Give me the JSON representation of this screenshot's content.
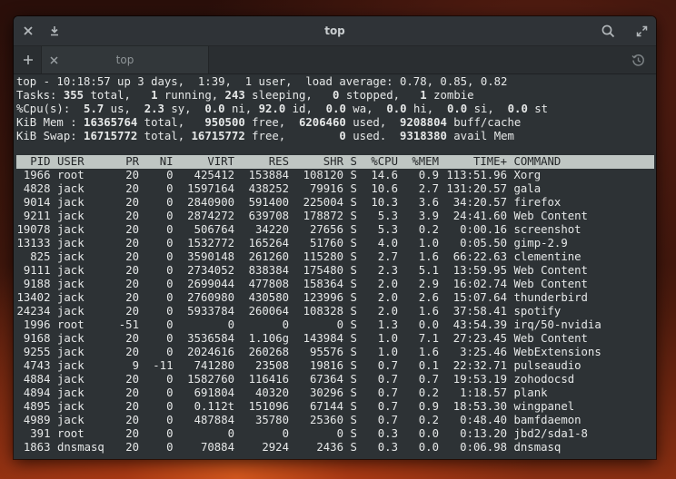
{
  "window": {
    "title": "top"
  },
  "tabs": [
    {
      "label": "top"
    }
  ],
  "summary": {
    "line1": "top - 10:18:57 up 3 days,  1:39,  1 user,  load average: 0.78, 0.85, 0.82",
    "tasks": {
      "label": "Tasks:",
      "total": "355",
      "total_l": " total,",
      "running": "1",
      "running_l": " running,",
      "sleeping": "243",
      "sleeping_l": " sleeping,",
      "stopped": "0",
      "stopped_l": " stopped,",
      "zombie": "1",
      "zombie_l": " zombie"
    },
    "cpu": {
      "label": "%Cpu(s):",
      "us": "5.7",
      "us_l": " us,",
      "sy": "2.3",
      "sy_l": " sy,",
      "ni": "0.0",
      "ni_l": " ni,",
      "id": "92.0",
      "id_l": " id,",
      "wa": "0.0",
      "wa_l": " wa,",
      "hi": "0.0",
      "hi_l": " hi,",
      "si": "0.0",
      "si_l": " si,",
      "st": "0.0",
      "st_l": " st"
    },
    "mem": {
      "label": "KiB Mem :",
      "total": "16365764",
      "total_l": " total,",
      "free": "950500",
      "free_l": " free,",
      "used": "6206460",
      "used_l": " used,",
      "buff": "9208804",
      "buff_l": " buff/cache"
    },
    "swap": {
      "label": "KiB Swap:",
      "total": "16715772",
      "total_l": " total,",
      "free": "16715772",
      "free_l": " free,",
      "used": "0",
      "used_l": " used.",
      "avail": "9318380",
      "avail_l": " avail Mem"
    }
  },
  "columns": [
    "PID",
    "USER",
    "PR",
    "NI",
    "VIRT",
    "RES",
    "SHR",
    "S",
    "%CPU",
    "%MEM",
    "TIME+",
    "COMMAND"
  ],
  "processes": [
    [
      "1966",
      "root",
      "20",
      "0",
      "425412",
      "153884",
      "108120",
      "S",
      "14.6",
      "0.9",
      "113:51.96",
      "Xorg"
    ],
    [
      "4828",
      "jack",
      "20",
      "0",
      "1597164",
      "438252",
      "79916",
      "S",
      "10.6",
      "2.7",
      "131:20.57",
      "gala"
    ],
    [
      "9014",
      "jack",
      "20",
      "0",
      "2840900",
      "591400",
      "225004",
      "S",
      "10.3",
      "3.6",
      "34:20.57",
      "firefox"
    ],
    [
      "9211",
      "jack",
      "20",
      "0",
      "2874272",
      "639708",
      "178872",
      "S",
      "5.3",
      "3.9",
      "24:41.60",
      "Web Content"
    ],
    [
      "19078",
      "jack",
      "20",
      "0",
      "506764",
      "34220",
      "27656",
      "S",
      "5.3",
      "0.2",
      "0:00.16",
      "screenshot"
    ],
    [
      "13133",
      "jack",
      "20",
      "0",
      "1532772",
      "165264",
      "51760",
      "S",
      "4.0",
      "1.0",
      "0:05.50",
      "gimp-2.9"
    ],
    [
      "825",
      "jack",
      "20",
      "0",
      "3590148",
      "261260",
      "115280",
      "S",
      "2.7",
      "1.6",
      "66:22.63",
      "clementine"
    ],
    [
      "9111",
      "jack",
      "20",
      "0",
      "2734052",
      "838384",
      "175480",
      "S",
      "2.3",
      "5.1",
      "13:59.95",
      "Web Content"
    ],
    [
      "9188",
      "jack",
      "20",
      "0",
      "2699044",
      "477808",
      "158364",
      "S",
      "2.0",
      "2.9",
      "16:02.74",
      "Web Content"
    ],
    [
      "13402",
      "jack",
      "20",
      "0",
      "2760980",
      "430580",
      "123996",
      "S",
      "2.0",
      "2.6",
      "15:07.64",
      "thunderbird"
    ],
    [
      "24234",
      "jack",
      "20",
      "0",
      "5933784",
      "260064",
      "108328",
      "S",
      "2.0",
      "1.6",
      "37:58.41",
      "spotify"
    ],
    [
      "1996",
      "root",
      "-51",
      "0",
      "0",
      "0",
      "0",
      "S",
      "1.3",
      "0.0",
      "43:54.39",
      "irq/50-nvidia"
    ],
    [
      "9168",
      "jack",
      "20",
      "0",
      "3536584",
      "1.106g",
      "143984",
      "S",
      "1.0",
      "7.1",
      "27:23.45",
      "Web Content"
    ],
    [
      "9255",
      "jack",
      "20",
      "0",
      "2024616",
      "260268",
      "95576",
      "S",
      "1.0",
      "1.6",
      "3:25.46",
      "WebExtensions"
    ],
    [
      "4743",
      "jack",
      "9",
      "-11",
      "741280",
      "23508",
      "19816",
      "S",
      "0.7",
      "0.1",
      "22:32.71",
      "pulseaudio"
    ],
    [
      "4884",
      "jack",
      "20",
      "0",
      "1582760",
      "116416",
      "67364",
      "S",
      "0.7",
      "0.7",
      "19:53.19",
      "zohodocsd"
    ],
    [
      "4894",
      "jack",
      "20",
      "0",
      "691804",
      "40320",
      "30296",
      "S",
      "0.7",
      "0.2",
      "1:18.57",
      "plank"
    ],
    [
      "4895",
      "jack",
      "20",
      "0",
      "0.112t",
      "151096",
      "67144",
      "S",
      "0.7",
      "0.9",
      "18:53.30",
      "wingpanel"
    ],
    [
      "4989",
      "jack",
      "20",
      "0",
      "487884",
      "35780",
      "25360",
      "S",
      "0.7",
      "0.2",
      "0:48.40",
      "bamfdaemon"
    ],
    [
      "391",
      "root",
      "20",
      "0",
      "0",
      "0",
      "0",
      "S",
      "0.3",
      "0.0",
      "0:13.20",
      "jbd2/sda1-8"
    ],
    [
      "1863",
      "dnsmasq",
      "20",
      "0",
      "70884",
      "2924",
      "2436",
      "S",
      "0.3",
      "0.0",
      "0:06.98",
      "dnsmasq"
    ]
  ]
}
